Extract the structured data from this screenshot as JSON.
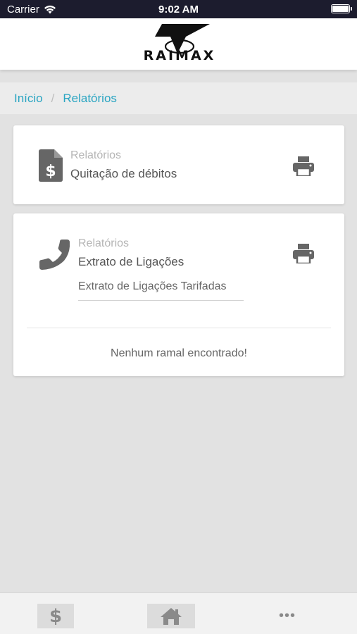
{
  "status_bar": {
    "carrier": "Carrier",
    "time": "9:02 AM"
  },
  "header": {
    "logo_text": "RAIMAX"
  },
  "breadcrumb": {
    "home": "Início",
    "separator": "/",
    "current": "Relatórios"
  },
  "cards": [
    {
      "subtitle": "Relatórios",
      "title": "Quitação de débitos",
      "icon": "invoice-dollar-icon",
      "action_icon": "print-icon"
    },
    {
      "subtitle": "Relatórios",
      "title": "Extrato de Ligações",
      "icon": "phone-icon",
      "action_icon": "print-icon",
      "select_value": "Extrato de Ligações Tarifadas",
      "empty_message": "Nenhum ramal encontrado!"
    }
  ],
  "bottom_nav": {
    "dollar": "$",
    "more": "•••"
  },
  "colors": {
    "accent": "#2aa5c2",
    "icon": "#666666",
    "status_bar": "#1c1c2e"
  }
}
